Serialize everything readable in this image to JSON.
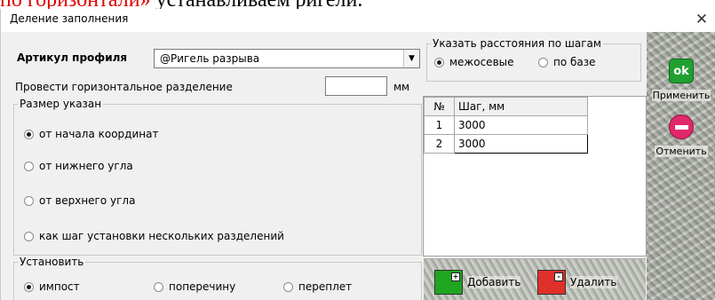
{
  "top_text": {
    "red_part": "по горизонтали»",
    "black_part": " устанавливаем ригели."
  },
  "window": {
    "title": "Деление заполнения",
    "close_glyph": "✕"
  },
  "profile": {
    "label": "Артикул профиля",
    "value": "@Ригель разрыва",
    "dropdown_glyph": "▼"
  },
  "horizontal": {
    "label": "Провести горизонтальное разделение",
    "value": "",
    "unit": "мм"
  },
  "size_group": {
    "legend": "Размер указан",
    "options": [
      {
        "label": "от начала координат",
        "checked": true
      },
      {
        "label": "от нижнего угла",
        "checked": false
      },
      {
        "label": "от верхнего угла",
        "checked": false
      },
      {
        "label": "как шаг установки нескольких разделений",
        "checked": false
      }
    ]
  },
  "install_group": {
    "legend": "Установить",
    "options": [
      {
        "label": "импост",
        "checked": true
      },
      {
        "label": "поперечину",
        "checked": false
      },
      {
        "label": "переплет",
        "checked": false
      }
    ]
  },
  "step_group": {
    "legend": "Указать расстояния по шагам",
    "options": [
      {
        "label": "межосевые",
        "checked": true
      },
      {
        "label": "по базе",
        "checked": false
      }
    ]
  },
  "table": {
    "headers": [
      "№",
      "Шаг, мм"
    ],
    "rows": [
      {
        "num": "1",
        "step": "3000"
      },
      {
        "num": "2",
        "step": "3000"
      }
    ]
  },
  "actions": {
    "apply": {
      "icon_text": "ok",
      "label": "Применить",
      "color": "#20a030"
    },
    "cancel": {
      "label": "Отменить",
      "color": "#e0286a"
    },
    "add": {
      "label": "Добавить",
      "color": "#1fa51f"
    },
    "delete": {
      "label": "Удалить",
      "color": "#e0302a"
    }
  }
}
